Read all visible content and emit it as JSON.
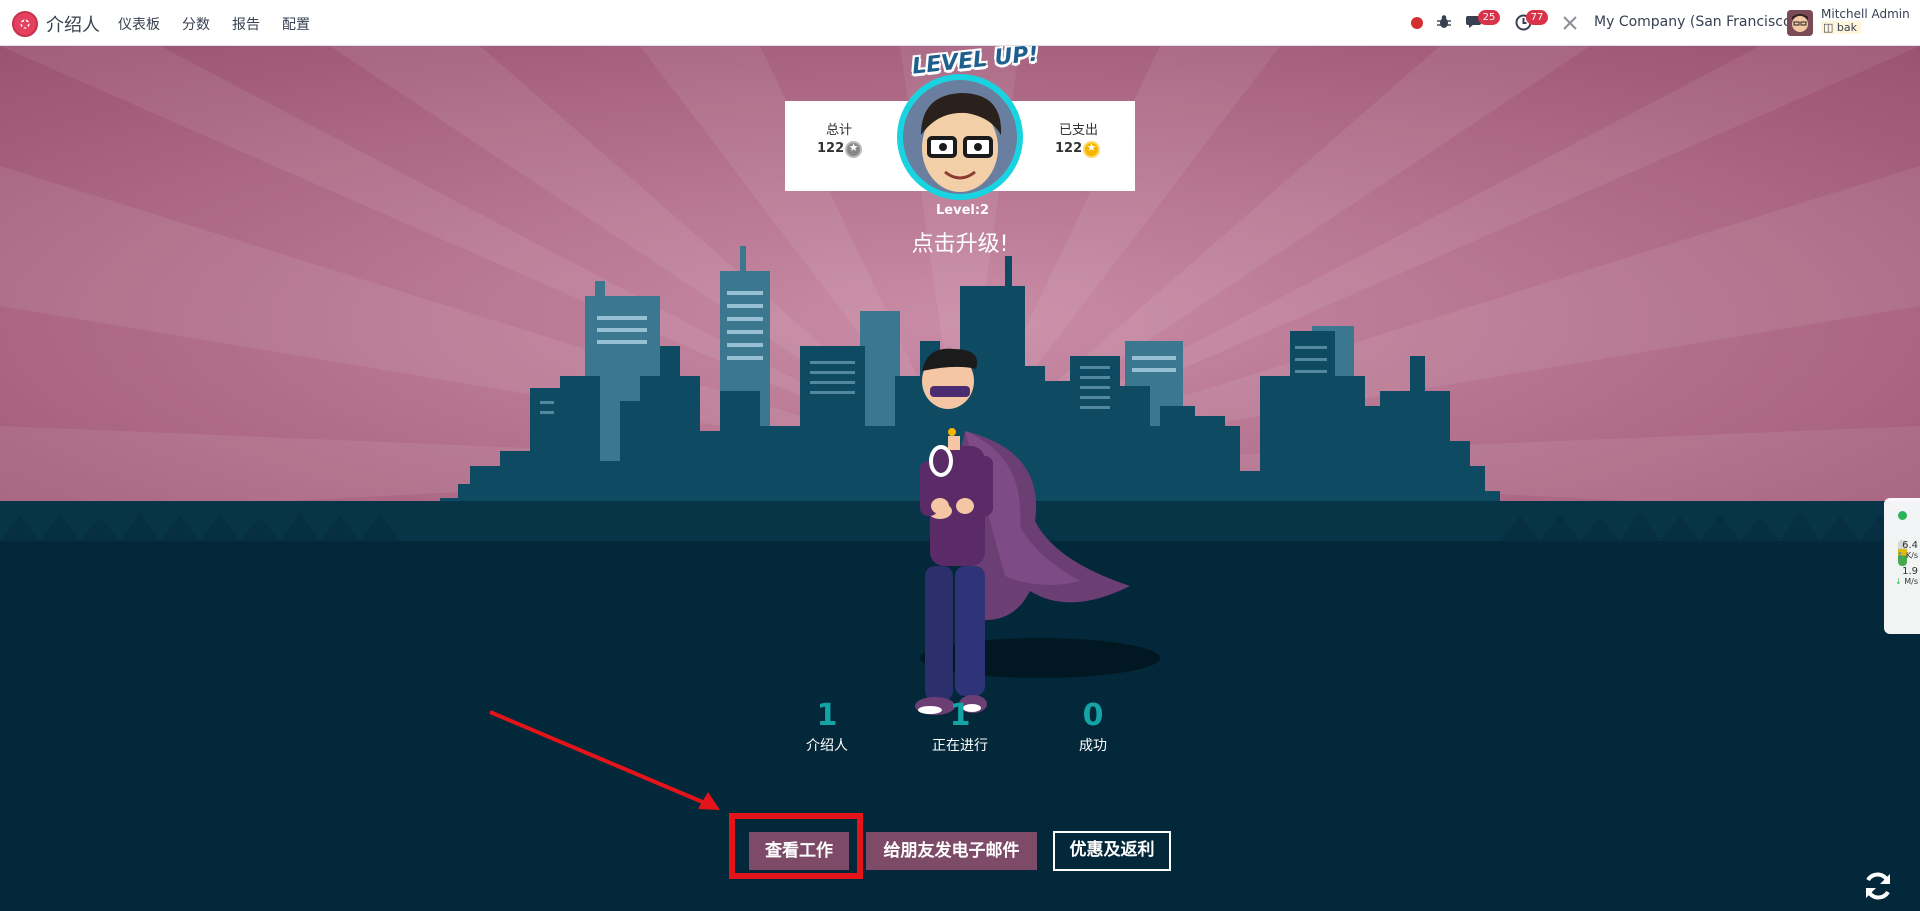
{
  "app": {
    "name": "介绍人",
    "menu": [
      "仪表板",
      "分数",
      "报告",
      "配置"
    ]
  },
  "systray": {
    "messages_count": "25",
    "activities_count": "77",
    "company": "My Company (San Francisco)",
    "user_name": "Mitchell Admin",
    "db_name": "bak"
  },
  "level": {
    "banner": "LEVEL UP!",
    "label": "Level:2",
    "cta": "点击升级!"
  },
  "points": {
    "total_label": "总计",
    "total_value": "122",
    "spent_label": "已支出",
    "spent_value": "122"
  },
  "stats": [
    {
      "value": "1",
      "label": "介绍人"
    },
    {
      "value": "1",
      "label": "正在进行"
    },
    {
      "value": "0",
      "label": "成功"
    }
  ],
  "buttons": {
    "view_jobs": "查看工作",
    "email_friends": "给朋友发电子邮件",
    "rewards": "优惠及返利"
  },
  "network_widget": {
    "up_value": "6.4",
    "up_unit": "K/s",
    "down_value": "1.9",
    "down_unit": "M/s"
  },
  "colors": {
    "sky": "#98536f",
    "city": "#1e5066",
    "ground": "#03283a",
    "accent_teal": "#15a4a6",
    "button_purple": "#7d4b68",
    "annotation_red": "#e3151a"
  }
}
